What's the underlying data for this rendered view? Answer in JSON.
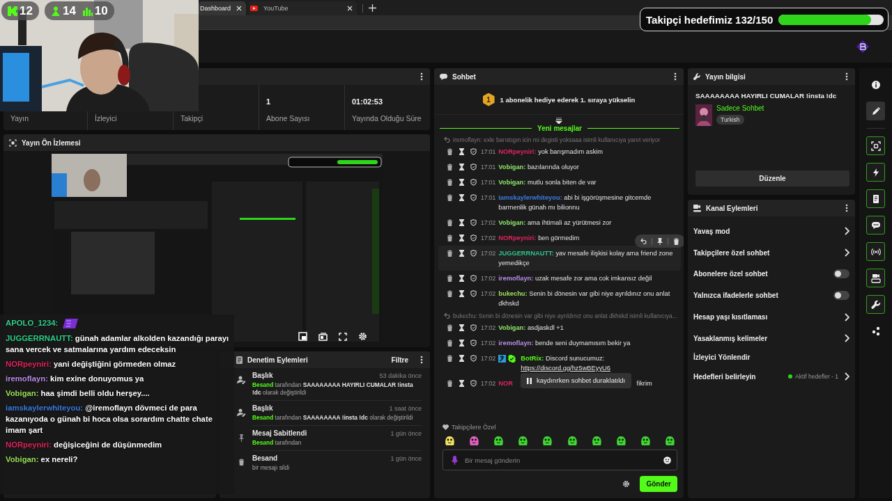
{
  "browser": {
    "tabs": [
      {
        "label": "Dashboard",
        "kind": "page",
        "selected": true
      },
      {
        "label": "YouTube",
        "kind": "video",
        "selected": false
      }
    ]
  },
  "webcam": {
    "kind": "picture",
    "counters": [
      {
        "kind": "kick",
        "value": "12"
      },
      {
        "kind": "followers",
        "value": "14"
      },
      {
        "kind": "viewers",
        "value": "10"
      }
    ]
  },
  "follower_goal": {
    "label": "Takipçi hedefimiz 132/150",
    "level": 0.88
  },
  "stats": [
    {
      "label": "Yayın"
    },
    {
      "label": "İzleyici"
    },
    {
      "label": "Takipçi"
    },
    {
      "value": "1",
      "label": "Abone Sayısı"
    },
    {
      "value": "01:02:53",
      "label": "Yayında Olduğu Süre"
    }
  ],
  "preview": {
    "title": "Yayın Ön İzlemesi"
  },
  "mod_actions": {
    "title": "Denetim Eylemleri",
    "filter": "Filtre",
    "items": [
      {
        "kind": "title",
        "title": "Başlık",
        "time": "53 dakika önce",
        "actor": "Besand",
        "text": "tarafından **SAAAAAAAA HAYIRLI CUMALAR !insta !dc** olarak değiştirildi"
      },
      {
        "kind": "title",
        "title": "Başlık",
        "time": "1 saat önce",
        "actor": "Besand",
        "text": "tarafından **SAAAAAAAA !insta !dc** olarak değiştirildi"
      },
      {
        "kind": "pin",
        "title": "Mesaj Sabitlendi",
        "time": "1 gün önce",
        "actor": "Besand",
        "text": "tarafından"
      },
      {
        "kind": "delete",
        "title": "Besand",
        "time": "1 gün önce",
        "text": "bir mesajı sildi"
      }
    ]
  },
  "chat": {
    "title": "Sohbet",
    "pinned": {
      "rank": "1",
      "text": "1 abonelik hediye ederek 1. sıraya yükselin"
    },
    "new_messages": "Yeni mesajlar",
    "messages": [
      {
        "kind": "reply",
        "text": "iremoflayn: exle barıstıgın icin mi degisti yoksaaa isimli kullanıcıya yanıt veriyor"
      },
      {
        "kind": "message",
        "time": "17:01",
        "user": "NORpeyniri:",
        "color": "#e0245e",
        "text": "yok barışmadım askim",
        "hovered": false
      },
      {
        "kind": "message",
        "time": "17:01",
        "user": "Vobigan:",
        "color": "#8ee86b",
        "text": "bazılarında oluyor",
        "hovered": false
      },
      {
        "kind": "message",
        "time": "17:01",
        "user": "Vobigan:",
        "color": "#8ee86b",
        "text": "mutlu sonla biten de var",
        "hovered": false
      },
      {
        "kind": "message",
        "time": "17:01",
        "user": "Iamskaylerwhiteyou:",
        "color": "#3b7be0",
        "text": "abi bi işgörüşmesine gitcemde barmenlik günah mı bilionnu",
        "hovered": false
      },
      {
        "kind": "message",
        "time": "17:02",
        "user": "Vobigan:",
        "color": "#8ee86b",
        "text": "ama ihtimali az yürütmesi zor",
        "hovered": false
      },
      {
        "kind": "message",
        "time": "17:02",
        "user": "NORpeyniri:",
        "color": "#e0245e",
        "text": "ben görmedim",
        "hovered": false
      },
      {
        "kind": "message",
        "time": "17:02",
        "user": "JUGGERRNAUTT:",
        "color": "#2cc58c",
        "text": "yav mesafe ilişkisi kolay ama friend zone yemedikçe",
        "hovered": true
      },
      {
        "kind": "message",
        "time": "17:02",
        "user": "iremoflayn:",
        "color": "#b98de9",
        "text": "uzak mesafe zor ama cok imkansız değil",
        "hovered": false
      },
      {
        "kind": "message",
        "time": "17:02",
        "user": "bukechu:",
        "color": "#9be05a",
        "text": "Senin bi dönesin var gibi niye ayrıldınız onu anlat dkhskd",
        "hovered": false
      },
      {
        "kind": "reply",
        "text": "bukechu: Senin bi dönesin var gibi niye ayrıldınız onu anlat dkhskd isimli kullanıcıya..."
      },
      {
        "kind": "message",
        "time": "17:02",
        "user": "Vobigan:",
        "color": "#8ee86b",
        "text": "asdjaskdl +1",
        "hovered": false
      },
      {
        "kind": "message",
        "time": "17:02",
        "user": "iremoflayn:",
        "color": "#b98de9",
        "text": "bende seni duymamısım bekir ya",
        "hovered": false
      },
      {
        "kind": "message",
        "time": "17:02",
        "user": "BotRix:",
        "color": "#53fc18",
        "moderator": true,
        "verified": true,
        "text": "Discord sunucumuz:",
        "link": "https://discord.gg/hz5wBEyyU6",
        "hovered": false
      },
      {
        "kind": "message",
        "time": "17:02",
        "user": "NOR",
        "color": "#e0245e",
        "text": "fikrim",
        "hovered": false,
        "notice": "kaydırırken sohbet duraklatıldı"
      }
    ],
    "emote_set": "Takipçilere Özel",
    "input": {
      "placeholder": "Bir mesaj gönderin"
    },
    "send": "Gönder"
  },
  "stream_info": {
    "title": "Yayın bilgisi",
    "stream_title": "SAAAAAAAA HAYIRLI CUMALAR !insta !dc",
    "category": "Sadece Sohbet",
    "tag": "Turkish",
    "edit": "Düzenle"
  },
  "channel_actions": {
    "title": "Kanal Eylemleri",
    "items": [
      {
        "kind": "link",
        "label": "Yavaş mod"
      },
      {
        "kind": "link",
        "label": "Takipçilere özel sohbet"
      },
      {
        "kind": "toggle",
        "label": "Abonelere özel sohbet",
        "on": false
      },
      {
        "kind": "toggle",
        "label": "Yalnızca ifadelerle sohbet",
        "on": false
      },
      {
        "kind": "link",
        "label": "Hesap yaşı kısıtlaması"
      },
      {
        "kind": "link",
        "label": "Yasaklanmış kelimeler"
      },
      {
        "kind": "plain",
        "label": "İzleyici Yönlendir"
      },
      {
        "kind": "goal",
        "label": "Hedefleri belirleyin",
        "status": "Aktif hedefler - 1"
      }
    ]
  },
  "rail": [
    {
      "kind": "info",
      "on": false,
      "selected": false
    },
    {
      "kind": "edit",
      "on": false,
      "selected": true
    },
    {
      "kind": "capture",
      "on": true,
      "selected": false
    },
    {
      "kind": "bolt",
      "on": true,
      "selected": false
    },
    {
      "kind": "document",
      "on": true,
      "selected": false
    },
    {
      "kind": "chat",
      "on": true,
      "selected": false
    },
    {
      "kind": "broadcast",
      "on": true,
      "selected": false
    },
    {
      "kind": "camera",
      "on": true,
      "selected": false
    },
    {
      "kind": "wrench",
      "on": true,
      "selected": false
    },
    {
      "kind": "dots",
      "on": false,
      "selected": false
    }
  ],
  "overlay_chat": [
    {
      "user": "APOLO_1234:",
      "color": "#2fd08a",
      "emote": true
    },
    {
      "user": "JUGGERRNAUTT:",
      "color": "#2fd08a",
      "text": "günah adamlar alkolden kazandığı parayı sana vercek ve satmalarına yardım edeceksin"
    },
    {
      "user": "NORpeyniri:",
      "color": "#e0245e",
      "text": "yani değiştiğini görmeden olmaz"
    },
    {
      "user": "iremoflayn:",
      "color": "#b98de9",
      "text": "kim exine donuyomus ya"
    },
    {
      "user": "Vobigan:",
      "color": "#9be05a",
      "text": "haa şimdi belli oldu herşey...."
    },
    {
      "user": "iamskaylerwhiteyou:",
      "color": "#3b7be0",
      "text": "@iremoflayn dövmeci de para kazanıyoda o günah bi hoca olsa sorardım chatte chate imam şart"
    },
    {
      "user": "NORpeyniri:",
      "color": "#e0245e",
      "text": "değişiceğini de düşünmedim"
    },
    {
      "user": "Vobigan:",
      "color": "#9be05a",
      "text": "ex nereli?"
    }
  ]
}
